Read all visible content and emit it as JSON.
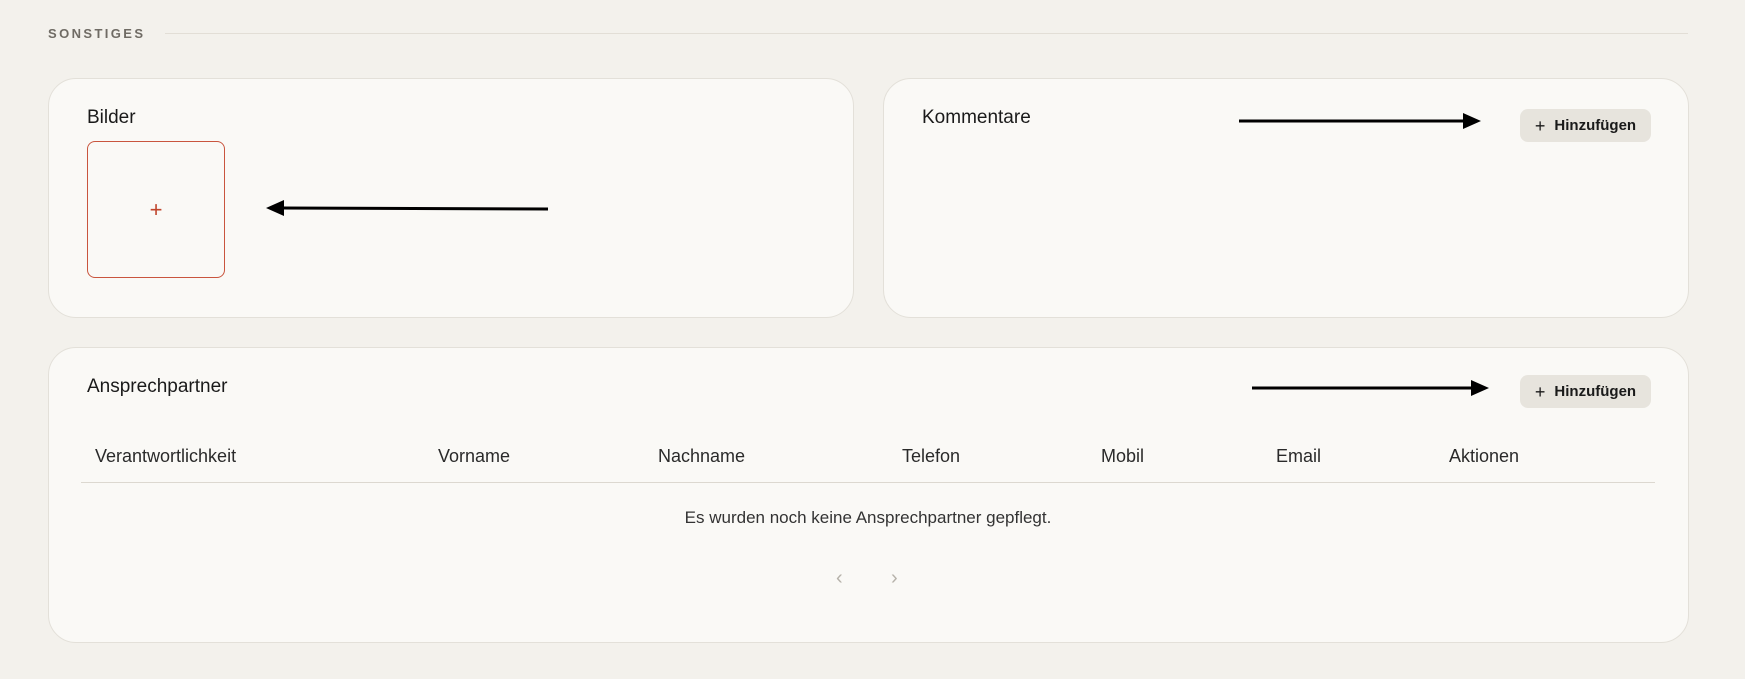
{
  "section": {
    "title": "SONSTIGES"
  },
  "bilder": {
    "title": "Bilder",
    "upload_icon": "+"
  },
  "kommentare": {
    "title": "Kommentare",
    "add_label": "Hinzufügen",
    "add_icon": "+"
  },
  "ansprechpartner": {
    "title": "Ansprechpartner",
    "add_label": "Hinzufügen",
    "add_icon": "+",
    "columns": [
      "Verantwortlichkeit",
      "Vorname",
      "Nachname",
      "Telefon",
      "Mobil",
      "Email",
      "Aktionen"
    ],
    "empty_message": "Es wurden noch keine Ansprechpartner gepflegt.",
    "pagination": {
      "prev_icon": "‹",
      "next_icon": "›"
    }
  },
  "colors": {
    "accent": "#c9553e",
    "background": "#f3f1ec",
    "card": "#faf9f6",
    "button": "#e7e4dd"
  }
}
